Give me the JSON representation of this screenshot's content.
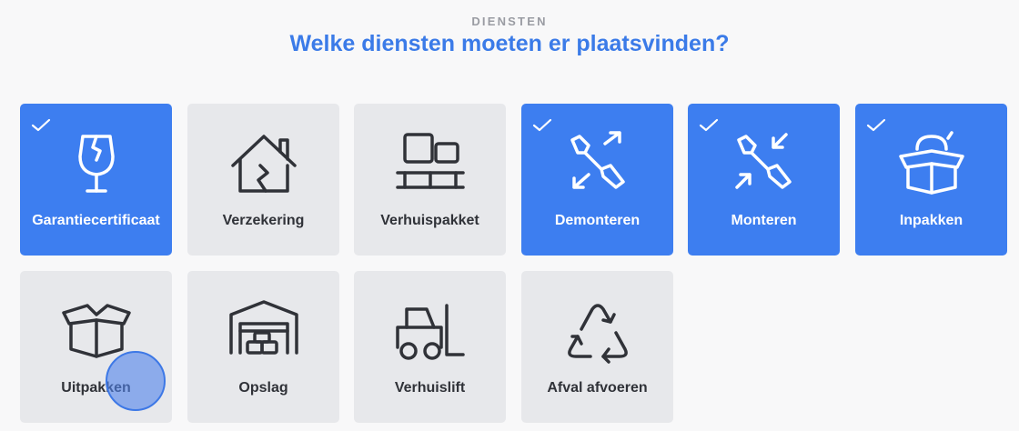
{
  "header": {
    "eyebrow": "DIENSTEN",
    "title": "Welke diensten moeten er plaatsvinden?"
  },
  "colors": {
    "accent": "#3d7ef0",
    "card_default": "#e7e8eb",
    "title": "#3b7be8"
  },
  "services": [
    {
      "label": "Garantiecertificaat",
      "icon": "broken-glass-icon",
      "selected": true
    },
    {
      "label": "Verzekering",
      "icon": "house-crack-icon",
      "selected": false
    },
    {
      "label": "Verhuispakket",
      "icon": "boxes-on-pallet-icon",
      "selected": false
    },
    {
      "label": "Demonteren",
      "icon": "screwdriver-expand-icon",
      "selected": true
    },
    {
      "label": "Monteren",
      "icon": "screwdriver-compress-icon",
      "selected": true
    },
    {
      "label": "Inpakken",
      "icon": "packing-box-icon",
      "selected": true
    },
    {
      "label": "Uitpakken",
      "icon": "open-box-icon",
      "selected": false
    },
    {
      "label": "Opslag",
      "icon": "storage-garage-icon",
      "selected": false
    },
    {
      "label": "Verhuislift",
      "icon": "forklift-icon",
      "selected": false
    },
    {
      "label": "Afval afvoeren",
      "icon": "recycle-icon",
      "selected": false
    }
  ]
}
